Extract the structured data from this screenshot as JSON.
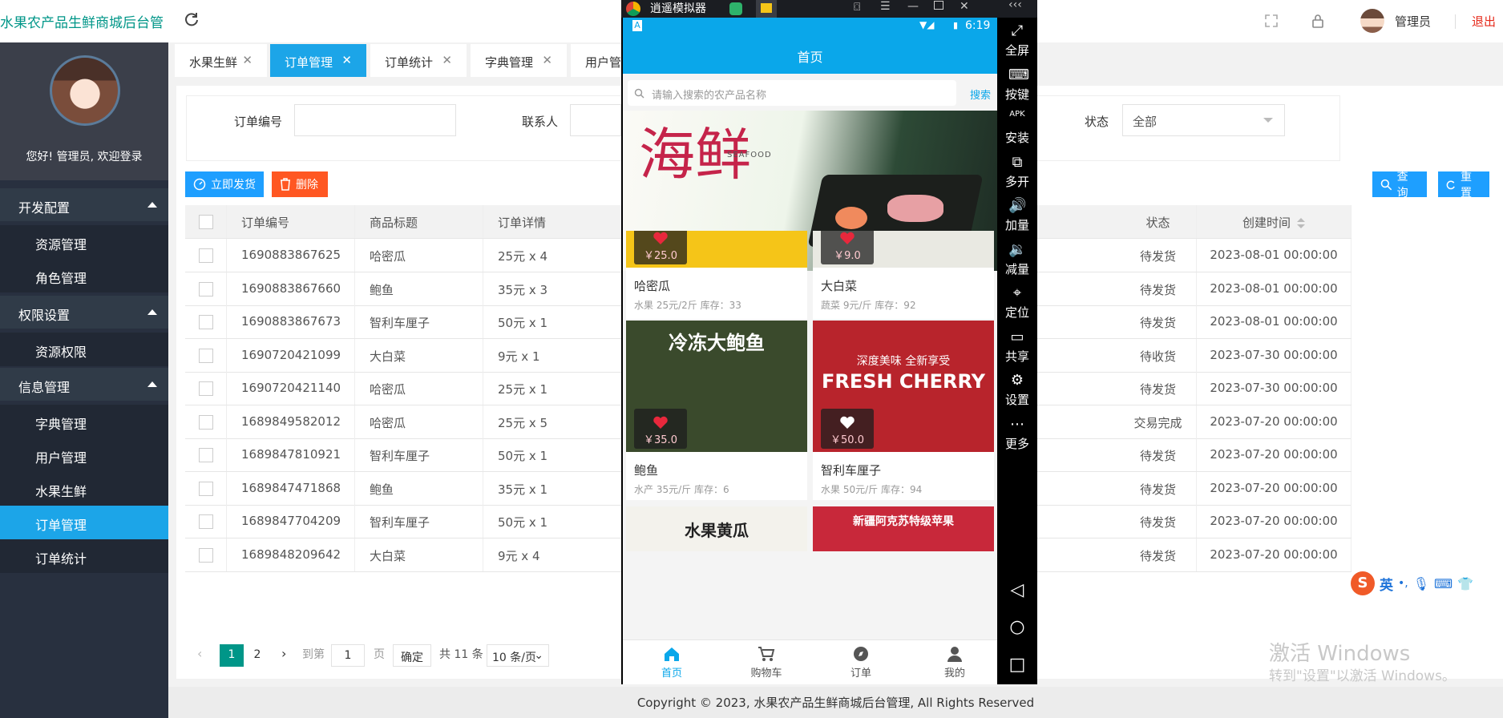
{
  "header": {
    "title": "水果农产品生鲜商城后台管",
    "user": "管理员",
    "logout": "退出"
  },
  "sidebar": {
    "welcome": "您好! 管理员, 欢迎登录",
    "groups": [
      {
        "label": "开发配置",
        "items": [
          "资源管理",
          "角色管理"
        ]
      },
      {
        "label": "权限设置",
        "items": [
          "资源权限"
        ]
      },
      {
        "label": "信息管理",
        "items": [
          "字典管理",
          "用户管理",
          "水果生鲜",
          "订单管理",
          "订单统计"
        ]
      }
    ],
    "active_item": "订单管理"
  },
  "tabs": [
    "水果生鲜",
    "订单管理",
    "订单统计",
    "字典管理",
    "用户管"
  ],
  "active_tab": "订单管理",
  "filters": {
    "order_no_label": "订单编号",
    "contact_label": "联系人",
    "status_label": "状态",
    "status_value": "全部"
  },
  "actions": {
    "ship": "立即发货",
    "delete": "删除",
    "query": "查询",
    "reset": "重置"
  },
  "table": {
    "headers": [
      "订单编号",
      "商品标题",
      "订单详情",
      "状态",
      "创建时间"
    ],
    "rows": [
      [
        "1690883867625",
        "哈密瓜",
        "25元 x 4",
        "待发货",
        "2023-08-01 00:00:00"
      ],
      [
        "1690883867660",
        "鲍鱼",
        "35元 x 3",
        "待发货",
        "2023-08-01 00:00:00"
      ],
      [
        "1690883867673",
        "智利车厘子",
        "50元 x 1",
        "待发货",
        "2023-08-01 00:00:00"
      ],
      [
        "1690720421099",
        "大白菜",
        "9元 x 1",
        "待收货",
        "2023-07-30 00:00:00"
      ],
      [
        "1690720421140",
        "哈密瓜",
        "25元 x 1",
        "待发货",
        "2023-07-30 00:00:00"
      ],
      [
        "1689849582012",
        "哈密瓜",
        "25元 x 5",
        "交易完成",
        "2023-07-20 00:00:00"
      ],
      [
        "1689847810921",
        "智利车厘子",
        "50元 x 1",
        "待发货",
        "2023-07-20 00:00:00"
      ],
      [
        "1689847471868",
        "鲍鱼",
        "35元 x 1",
        "待发货",
        "2023-07-20 00:00:00"
      ],
      [
        "1689847704209",
        "智利车厘子",
        "50元 x 1",
        "待发货",
        "2023-07-20 00:00:00"
      ],
      [
        "1689848209642",
        "大白菜",
        "9元 x 4",
        "待发货",
        "2023-07-20 00:00:00"
      ]
    ]
  },
  "pagination": {
    "pages": [
      "1",
      "2"
    ],
    "current": "1",
    "goto_label": "到第",
    "goto_value": "1",
    "page_unit": "页",
    "confirm": "确定",
    "total": "共 11 条",
    "page_size": "10 条/页"
  },
  "footer": "Copyright © 2023, 水果农产品生鲜商城后台管理, All Rights Reserved",
  "emulator": {
    "title": "逍遥模拟器",
    "time": "6:19",
    "app_title": "首页",
    "search_placeholder": "请输入搜索的农产品名称",
    "search_btn": "搜索",
    "banner_text_cn": "海鲜",
    "banner_text_en": "SEAFOOD",
    "products": [
      {
        "name": "哈密瓜",
        "meta": "水果 25元/2斤 库存：33",
        "price": "￥25.0",
        "color": "#f5c518"
      },
      {
        "name": "大白菜",
        "meta": "蔬菜 9元/斤 库存：92",
        "price": "￥9.0",
        "color": "#e9e9e2"
      },
      {
        "name": "鲍鱼",
        "meta": "水产 35元/斤 库存：6",
        "price": "￥35.0",
        "color": "#3a4a2c",
        "img_text": "冷冻大鲍鱼"
      },
      {
        "name": "智利车厘子",
        "meta": "水果 50元/斤 库存：94",
        "price": "￥50.0",
        "color": "#b8242c",
        "img_text": "FRESH CHERRY",
        "img_sub": "深度美味 全新享受"
      },
      {
        "name": "水果黄瓜",
        "color": "#f3f2ec",
        "img_text": "水果黄瓜"
      },
      {
        "name": "新疆阿克苏特级苹果",
        "color": "#c8283a",
        "img_text": "新疆阿克苏特级苹果"
      }
    ],
    "nav": [
      "首页",
      "购物车",
      "订单",
      "我的"
    ],
    "side_buttons": [
      "全屏",
      "按键",
      "安装",
      "多开",
      "加量",
      "减量",
      "定位",
      "共享",
      "设置",
      "更多"
    ]
  },
  "ime": {
    "label": "英"
  },
  "watermark": {
    "line1": "激活 Windows",
    "line2": "转到\"设置\"以激活 Windows。"
  }
}
